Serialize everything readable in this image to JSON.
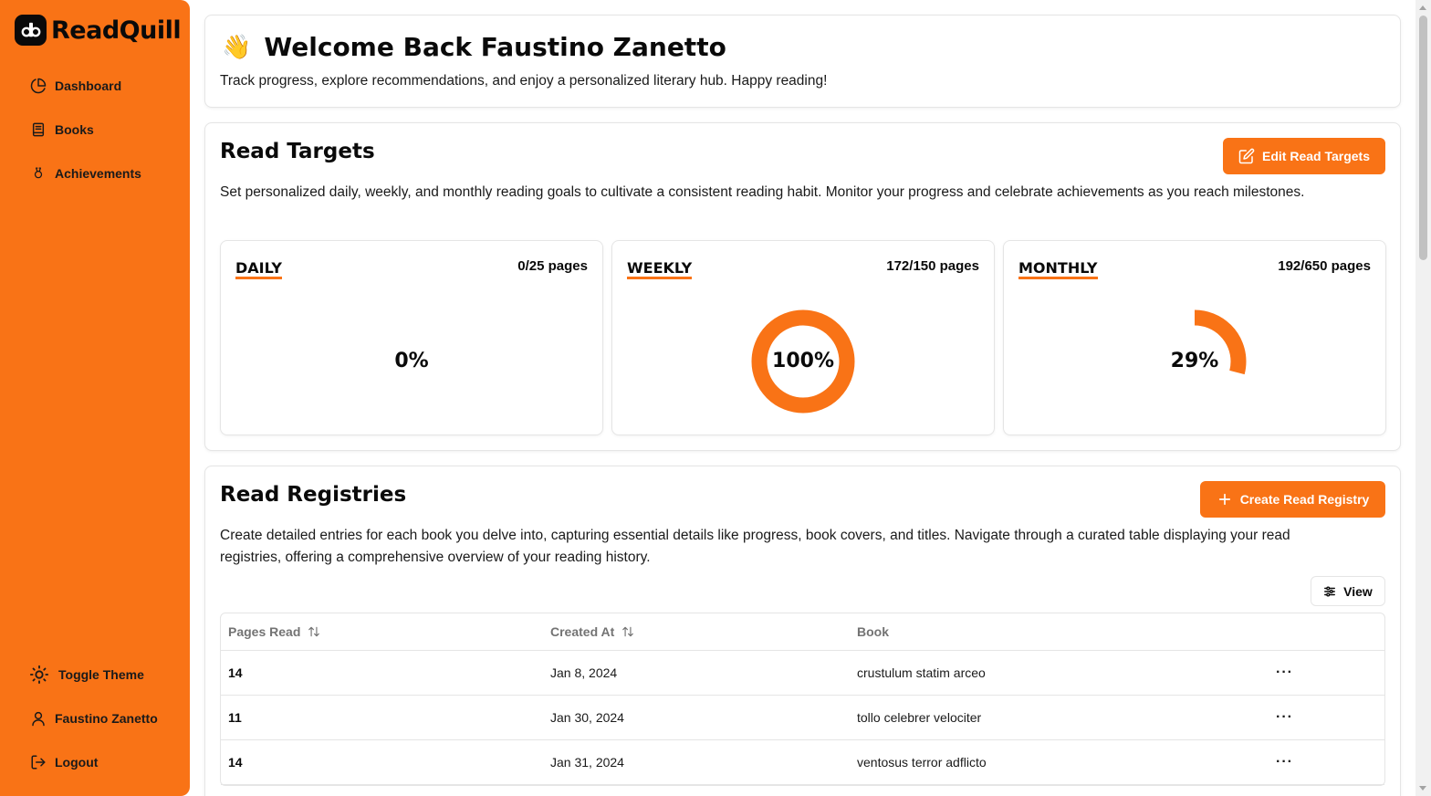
{
  "app": {
    "name": "ReadQuill"
  },
  "sidebar": {
    "items": [
      {
        "label": "Dashboard",
        "icon": "pie-chart-icon"
      },
      {
        "label": "Books",
        "icon": "book-icon"
      },
      {
        "label": "Achievements",
        "icon": "award-icon"
      }
    ],
    "footer": [
      {
        "label": "Toggle Theme",
        "icon": "sun-icon"
      },
      {
        "label": "Faustino Zanetto",
        "icon": "user-icon"
      },
      {
        "label": "Logout",
        "icon": "logout-icon"
      }
    ]
  },
  "welcome": {
    "emoji": "👋",
    "title": "Welcome Back Faustino Zanetto",
    "subtitle": "Track progress, explore recommendations, and enjoy a personalized literary hub. Happy reading!"
  },
  "targets": {
    "title": "Read Targets",
    "edit_button": "Edit Read Targets",
    "description": "Set personalized daily, weekly, and monthly reading goals to cultivate a consistent reading habit. Monitor your progress and celebrate achievements as you reach milestones.",
    "cards": [
      {
        "label": "DAILY",
        "count": "0/25 pages",
        "percent_label": "0%",
        "progress": 0
      },
      {
        "label": "WEEKLY",
        "count": "172/150 pages",
        "percent_label": "100%",
        "progress": 1
      },
      {
        "label": "MONTHLY",
        "count": "192/650 pages",
        "percent_label": "29%",
        "progress": 0.29
      }
    ]
  },
  "registries": {
    "title": "Read Registries",
    "create_button": "Create Read Registry",
    "description": "Create detailed entries for each book you delve into, capturing essential details like progress, book covers, and titles. Navigate through a curated table displaying your read registries, offering a comprehensive overview of your reading history.",
    "view_button": "View",
    "columns": [
      "Pages Read",
      "Created At",
      "Book"
    ],
    "rows": [
      {
        "pages": "14",
        "created": "Jan 8, 2024",
        "book": "crustulum statim arceo",
        "actions": "···"
      },
      {
        "pages": "11",
        "created": "Jan 30, 2024",
        "book": "tollo celebrer velociter",
        "actions": "···"
      },
      {
        "pages": "14",
        "created": "Jan 31, 2024",
        "book": "ventosus terror adflicto",
        "actions": "···"
      }
    ]
  },
  "colors": {
    "accent": "#f97316",
    "text": "#0a0a0a",
    "muted": "#737373",
    "border": "#e5e5e5"
  }
}
